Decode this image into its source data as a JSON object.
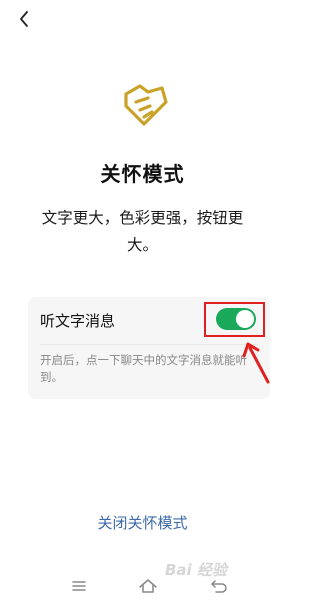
{
  "header": {
    "back_icon": "chevron-left-icon"
  },
  "logo": {
    "icon": "heart-hand-icon",
    "color": "#c9a227"
  },
  "mode": {
    "title": "关怀模式",
    "description": "文字更大，色彩更强，按钮更大。"
  },
  "setting": {
    "label": "听文字消息",
    "toggle_on": true,
    "toggle_color": "#1aa85a",
    "description": "开启后，点一下聊天中的文字消息就能听到。"
  },
  "annotation": {
    "highlight_color": "#e02020"
  },
  "footer": {
    "close_label": "关闭关怀模式",
    "link_color": "#3c6aa8"
  },
  "navbar": {
    "menu_icon": "menu-icon",
    "home_icon": "home-icon",
    "back_icon": "back-icon"
  },
  "watermark": {
    "text": "Bai 经验"
  }
}
